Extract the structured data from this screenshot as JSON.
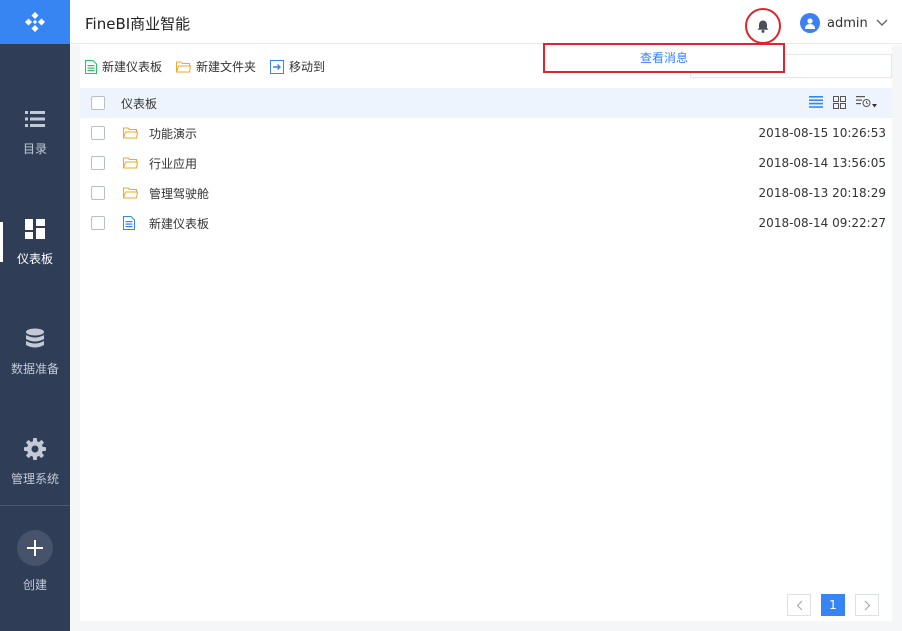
{
  "app": {
    "title": "FineBI商业智能"
  },
  "sidebar": {
    "items": [
      {
        "label": "目录",
        "icon": "list-icon"
      },
      {
        "label": "仪表板",
        "icon": "dashboard-icon"
      },
      {
        "label": "数据准备",
        "icon": "database-icon"
      },
      {
        "label": "管理系统",
        "icon": "gear-icon"
      }
    ],
    "create_label": "创建"
  },
  "header": {
    "user": "admin",
    "popup_label": "查看消息"
  },
  "toolbar": {
    "new_dashboard": "新建仪表板",
    "new_folder": "新建文件夹",
    "move_to": "移动到"
  },
  "list": {
    "header_label": "仪表板",
    "rows": [
      {
        "name": "功能演示",
        "type": "folder",
        "time": "2018-08-15 10:26:53"
      },
      {
        "name": "行业应用",
        "type": "folder",
        "time": "2018-08-14 13:56:05"
      },
      {
        "name": "管理驾驶舱",
        "type": "folder",
        "time": "2018-08-13 20:18:29"
      },
      {
        "name": "新建仪表板",
        "type": "dashboard",
        "time": "2018-08-14 09:22:27"
      }
    ]
  },
  "pager": {
    "current": "1"
  },
  "colors": {
    "accent": "#3685f2",
    "sidebar": "#2f3d57",
    "highlight": "#e0242b",
    "folder": "#f5a623",
    "green": "#2bbf6a"
  }
}
